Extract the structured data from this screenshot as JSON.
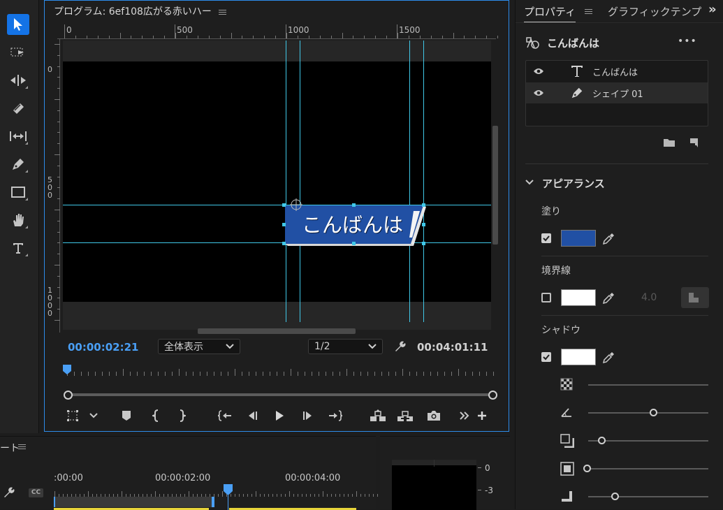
{
  "toolbar": {
    "tools": [
      "selection-tool",
      "track-select-tool",
      "ripple-edit-tool",
      "razor-tool",
      "slip-tool",
      "pen-tool",
      "rectangle-tool",
      "hand-tool",
      "type-tool"
    ]
  },
  "monitor": {
    "title": "プログラム: 6ef108広がる赤いハー",
    "ruler_h": [
      "0",
      "500",
      "1000",
      "1500"
    ],
    "ruler_v": [
      {
        "digits": "0"
      },
      {
        "digits": "500"
      },
      {
        "digits": "1000"
      }
    ],
    "graphic_text": "こんばんは",
    "current_time": "00:00:02:21",
    "zoom": "全体表示",
    "resolution": "1/2",
    "duration": "00:04:01:11",
    "accent_color": "#2d8ceb",
    "guide_color": "#40c8e8"
  },
  "properties": {
    "tab_active": "プロパティ",
    "tab_other": "グラフィックテンプ",
    "more_label": "»",
    "object_name": "こんばんは",
    "more_menu": "•••",
    "layers": [
      {
        "name": "こんばんは",
        "type": "text"
      },
      {
        "name": "シェイプ 01",
        "type": "shape"
      }
    ],
    "appearance_title": "アピアランス",
    "fill_label": "塗り",
    "fill_color": "#2150a4",
    "stroke_label": "境界線",
    "stroke_color": "#ffffff",
    "stroke_width": "4.0",
    "shadow_label": "シャドウ",
    "shadow_color": "#ffffff"
  },
  "bottom": {
    "panel_title": "ート",
    "times": [
      ":00:00",
      "00:00:02:00",
      "00:00:04:00"
    ],
    "meter_labels": [
      "0",
      "-3"
    ],
    "clip_color": "#e8d53a"
  }
}
